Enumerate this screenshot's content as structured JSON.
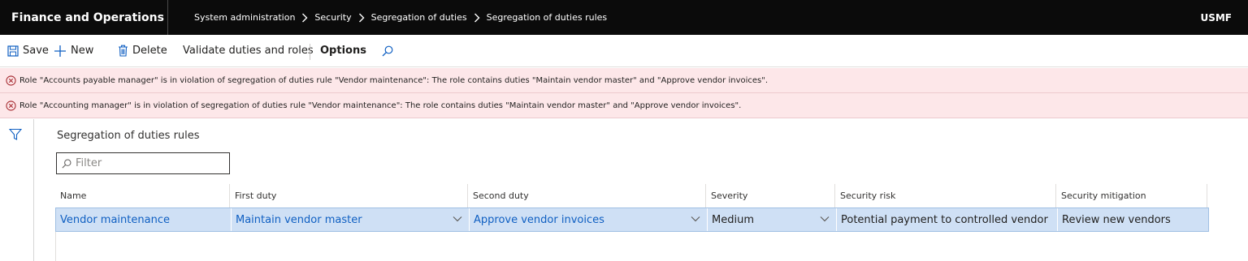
{
  "navbar": {
    "app_title": "Finance and Operations",
    "breadcrumb": [
      "System administration",
      "Security",
      "Segregation of duties",
      "Segregation of duties rules"
    ],
    "company": "USMF",
    "background": "#0b0b0b"
  },
  "actions": {
    "save": "Save",
    "new": "New",
    "delete": "Delete",
    "validate": "Validate duties and roles",
    "options": "Options",
    "search_icon": "search-icon",
    "accent": "#0f5fc2"
  },
  "messages": [
    "Role \"Accounts payable manager\" is in violation of segregation of duties rule \"Vendor maintenance\": The role contains duties \"Maintain vendor master\" and \"Approve vendor invoices\".",
    "Role \"Accounting manager\" is in violation of segregation of duties rule \"Vendor maintenance\": The role contains duties \"Maintain vendor master\" and \"Approve vendor invoices\"."
  ],
  "message_color": "#fde7e9",
  "form": {
    "title": "Segregation of duties rules",
    "filter_placeholder": "Filter",
    "filter_value": ""
  },
  "grid": {
    "columns": [
      "Name",
      "First duty",
      "Second duty",
      "Severity",
      "Security risk",
      "Security mitigation"
    ],
    "rows": [
      {
        "name": "Vendor maintenance",
        "first_duty": "Maintain vendor master",
        "second_duty": "Approve vendor invoices",
        "severity": "Medium",
        "security_risk": "Potential payment to controlled vendor",
        "security_mitigation": "Review new vendors"
      }
    ],
    "selected_row_color": "#cfe0f5"
  }
}
